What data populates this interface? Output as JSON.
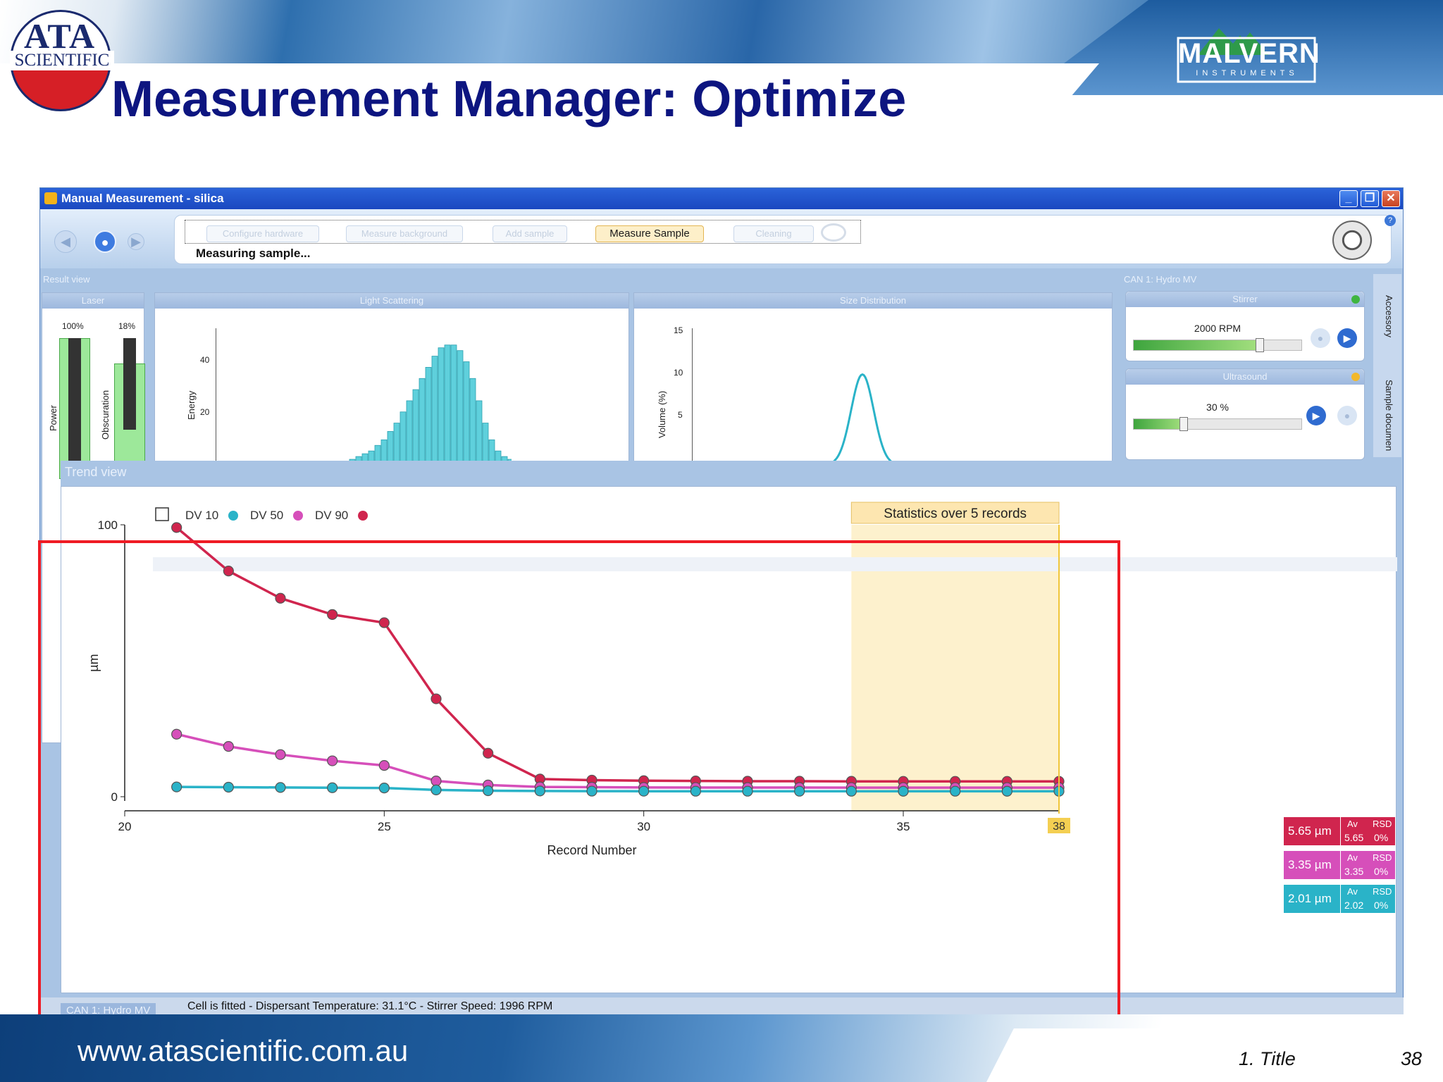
{
  "slide": {
    "title": "Measurement Manager: Optimize",
    "logo_left": {
      "line1": "ATA",
      "line2": "SCIENTIFIC"
    },
    "logo_right": {
      "name": "MALVERN",
      "sub": "INSTRUMENTS"
    },
    "footer_url": "www.atascientific.com.au",
    "footer_section": "1. Title",
    "page_number": "38",
    "colors": {
      "title": "#0d1580",
      "highlight_box": "#ef1b24"
    }
  },
  "window": {
    "title": "Manual Measurement - silica",
    "buttons": {
      "minimize": "_",
      "restore": "❐",
      "close": "✕"
    },
    "wizard_steps": [
      "Configure hardware",
      "Measure background",
      "Add sample",
      "Measure Sample",
      "Cleaning"
    ],
    "active_step": "Measure Sample",
    "status": "Measuring sample..."
  },
  "result_view": {
    "label": "Result view",
    "laser": {
      "header": "Laser",
      "power_pct": "100%",
      "obscuration_pct": "18%",
      "power_label": "Power",
      "obscuration_label": "Obscuration"
    },
    "light_scattering": {
      "header": "Light Scattering",
      "ylabel": "Energy",
      "yticks": [
        "40",
        "20"
      ]
    },
    "size_distribution": {
      "header": "Size Distribution",
      "ylabel": "Volume (%)",
      "yticks": [
        "15",
        "10",
        "5"
      ]
    }
  },
  "cell_panel": {
    "header": "CAN 1: Hydro MV",
    "stirrer": {
      "header": "Stirrer",
      "value": "2000",
      "unit": "RPM",
      "level": 0.75
    },
    "ultrasound": {
      "header": "Ultrasound",
      "value": "30",
      "unit": "%",
      "level": 0.3
    },
    "side_tabs": [
      "Accessory",
      "Sample documen"
    ]
  },
  "trend_view": {
    "label": "Trend view",
    "stats_label": "Statistics over 5 records",
    "current_record": "38",
    "readouts": [
      {
        "value": "5.65 µm",
        "av_label": "Av",
        "rsd_label": "RSD",
        "av": "5.65",
        "rsd": "0%",
        "color": "#d0254e"
      },
      {
        "value": "3.35 µm",
        "av_label": "Av",
        "rsd_label": "RSD",
        "av": "3.35",
        "rsd": "0%",
        "color": "#d64fba"
      },
      {
        "value": "2.01 µm",
        "av_label": "Av",
        "rsd_label": "RSD",
        "av": "2.02",
        "rsd": "0%",
        "color": "#2ab3c8"
      }
    ]
  },
  "status_bar": {
    "tab": "CAN 1: Hydro MV",
    "text": "Cell is fitted  - Dispersant Temperature: 31.1°C - Stirrer Speed: 1996 RPM"
  },
  "chart_data": {
    "type": "line",
    "title": "",
    "xlabel": "Record Number",
    "ylabel": "µm",
    "xlim": [
      20,
      38
    ],
    "ylim": [
      -3,
      100
    ],
    "xticks": [
      20,
      25,
      30,
      35
    ],
    "yticks": [
      0,
      100
    ],
    "legend_placement": "top-left",
    "x": [
      21,
      22,
      23,
      24,
      25,
      26,
      27,
      28,
      29,
      30,
      31,
      32,
      33,
      34,
      35,
      36,
      37,
      38
    ],
    "series": [
      {
        "name": "DV 10",
        "color": "#2ab3c8",
        "values": [
          3.6,
          3.5,
          3.4,
          3.3,
          3.2,
          2.5,
          2.2,
          2.1,
          2.05,
          2.03,
          2.02,
          2.02,
          2.02,
          2.02,
          2.01,
          2.02,
          2.01,
          2.01
        ]
      },
      {
        "name": "DV 50",
        "color": "#d64fba",
        "values": [
          23,
          18.5,
          15.5,
          13.2,
          11.5,
          5.8,
          4.3,
          3.6,
          3.5,
          3.4,
          3.38,
          3.36,
          3.36,
          3.35,
          3.35,
          3.35,
          3.35,
          3.35
        ]
      },
      {
        "name": "DV 90",
        "color": "#d0254e",
        "values": [
          99,
          83,
          73,
          67,
          64,
          36,
          16,
          6.5,
          6.1,
          5.9,
          5.8,
          5.7,
          5.7,
          5.66,
          5.65,
          5.65,
          5.65,
          5.65
        ]
      }
    ],
    "stats_records": [
      34,
      38
    ],
    "light_scattering_bars": [
      {
        "values": [
          1,
          2,
          3,
          4,
          6,
          8,
          11,
          14,
          18,
          22,
          26,
          30,
          34,
          38,
          41,
          42,
          42,
          40,
          36,
          30,
          22,
          14,
          8,
          4,
          2,
          1
        ]
      }
    ],
    "size_distribution_curve": {
      "peak": 11.5
    }
  }
}
